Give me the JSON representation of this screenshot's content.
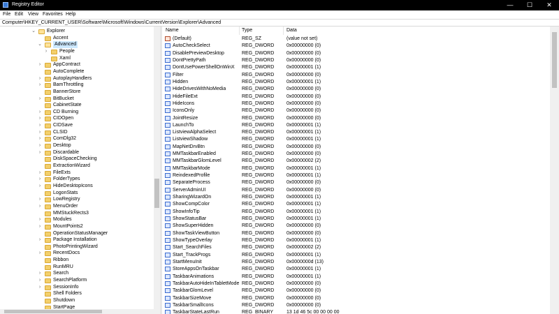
{
  "window": {
    "title": "Registry Editor",
    "minimize": "—",
    "maximize": "☐",
    "close": "✕"
  },
  "menu": [
    "File",
    "Edit",
    "View",
    "Favorites",
    "Help"
  ],
  "address": "Computer\\HKEY_CURRENT_USER\\Software\\Microsoft\\Windows\\CurrentVersion\\Explorer\\Advanced",
  "tree": [
    {
      "label": "Explorer",
      "level": 0,
      "exp": "⌄",
      "open": true
    },
    {
      "label": "Accent",
      "level": 1,
      "exp": ""
    },
    {
      "label": "Advanced",
      "level": 1,
      "exp": "⌄",
      "open": true,
      "selected": true
    },
    {
      "label": "People",
      "level": 2,
      "exp": "›"
    },
    {
      "label": "Xaml",
      "level": 2,
      "exp": ""
    },
    {
      "label": "AppContract",
      "level": 1,
      "exp": "›"
    },
    {
      "label": "AutoComplete",
      "level": 1,
      "exp": ""
    },
    {
      "label": "AutoplayHandlers",
      "level": 1,
      "exp": "›"
    },
    {
      "label": "BamThrottling",
      "level": 1,
      "exp": "›"
    },
    {
      "label": "BannerStore",
      "level": 1,
      "exp": ""
    },
    {
      "label": "BitBucket",
      "level": 1,
      "exp": "›"
    },
    {
      "label": "CabinetState",
      "level": 1,
      "exp": ""
    },
    {
      "label": "CD Burning",
      "level": 1,
      "exp": "›"
    },
    {
      "label": "CIDOpen",
      "level": 1,
      "exp": "›"
    },
    {
      "label": "CIDSave",
      "level": 1,
      "exp": "›"
    },
    {
      "label": "CLSID",
      "level": 1,
      "exp": "›"
    },
    {
      "label": "ComDlg32",
      "level": 1,
      "exp": "›"
    },
    {
      "label": "Desktop",
      "level": 1,
      "exp": "›"
    },
    {
      "label": "Discardable",
      "level": 1,
      "exp": "›"
    },
    {
      "label": "DiskSpaceChecking",
      "level": 1,
      "exp": ""
    },
    {
      "label": "ExtractionWizard",
      "level": 1,
      "exp": ""
    },
    {
      "label": "FileExts",
      "level": 1,
      "exp": "›"
    },
    {
      "label": "FolderTypes",
      "level": 1,
      "exp": "›"
    },
    {
      "label": "HideDesktopIcons",
      "level": 1,
      "exp": "›"
    },
    {
      "label": "LogonStats",
      "level": 1,
      "exp": ""
    },
    {
      "label": "LowRegistry",
      "level": 1,
      "exp": "›"
    },
    {
      "label": "MenuOrder",
      "level": 1,
      "exp": "›"
    },
    {
      "label": "MMStuckRects3",
      "level": 1,
      "exp": ""
    },
    {
      "label": "Modules",
      "level": 1,
      "exp": "›"
    },
    {
      "label": "MountPoints2",
      "level": 1,
      "exp": "›"
    },
    {
      "label": "OperationStatusManager",
      "level": 1,
      "exp": ""
    },
    {
      "label": "Package Installation",
      "level": 1,
      "exp": "›"
    },
    {
      "label": "PhotoPrintingWizard",
      "level": 1,
      "exp": ""
    },
    {
      "label": "RecentDocs",
      "level": 1,
      "exp": "›"
    },
    {
      "label": "Ribbon",
      "level": 1,
      "exp": ""
    },
    {
      "label": "RunMRU",
      "level": 1,
      "exp": ""
    },
    {
      "label": "Search",
      "level": 1,
      "exp": "›"
    },
    {
      "label": "SearchPlatform",
      "level": 1,
      "exp": "›"
    },
    {
      "label": "SessionInfo",
      "level": 1,
      "exp": "›"
    },
    {
      "label": "Shell Folders",
      "level": 1,
      "exp": ""
    },
    {
      "label": "Shutdown",
      "level": 1,
      "exp": ""
    },
    {
      "label": "StartPage",
      "level": 1,
      "exp": ""
    }
  ],
  "columns": [
    "Name",
    "Type",
    "Data"
  ],
  "values": [
    {
      "name": "(Default)",
      "type": "REG_SZ",
      "data": "(value not set)",
      "icon": "string"
    },
    {
      "name": "AutoCheckSelect",
      "type": "REG_DWORD",
      "data": "0x00000000 (0)",
      "icon": "binary"
    },
    {
      "name": "DisablePreviewDesktop",
      "type": "REG_DWORD",
      "data": "0x00000000 (0)",
      "icon": "binary"
    },
    {
      "name": "DontPrettyPath",
      "type": "REG_DWORD",
      "data": "0x00000000 (0)",
      "icon": "binary"
    },
    {
      "name": "DontUsePowerShellOnWinX",
      "type": "REG_DWORD",
      "data": "0x00000001 (1)",
      "icon": "binary"
    },
    {
      "name": "Filter",
      "type": "REG_DWORD",
      "data": "0x00000000 (0)",
      "icon": "binary"
    },
    {
      "name": "Hidden",
      "type": "REG_DWORD",
      "data": "0x00000001 (1)",
      "icon": "binary"
    },
    {
      "name": "HideDrivesWithNoMedia",
      "type": "REG_DWORD",
      "data": "0x00000000 (0)",
      "icon": "binary"
    },
    {
      "name": "HideFileExt",
      "type": "REG_DWORD",
      "data": "0x00000000 (0)",
      "icon": "binary"
    },
    {
      "name": "HideIcons",
      "type": "REG_DWORD",
      "data": "0x00000000 (0)",
      "icon": "binary"
    },
    {
      "name": "IconsOnly",
      "type": "REG_DWORD",
      "data": "0x00000000 (0)",
      "icon": "binary"
    },
    {
      "name": "JointResize",
      "type": "REG_DWORD",
      "data": "0x00000000 (0)",
      "icon": "binary"
    },
    {
      "name": "LaunchTo",
      "type": "REG_DWORD",
      "data": "0x00000001 (1)",
      "icon": "binary"
    },
    {
      "name": "ListviewAlphaSelect",
      "type": "REG_DWORD",
      "data": "0x00000001 (1)",
      "icon": "binary"
    },
    {
      "name": "ListviewShadow",
      "type": "REG_DWORD",
      "data": "0x00000001 (1)",
      "icon": "binary"
    },
    {
      "name": "MapNetDrvBtn",
      "type": "REG_DWORD",
      "data": "0x00000000 (0)",
      "icon": "binary"
    },
    {
      "name": "MMTaskbarEnabled",
      "type": "REG_DWORD",
      "data": "0x00000000 (0)",
      "icon": "binary"
    },
    {
      "name": "MMTaskbarGlomLevel",
      "type": "REG_DWORD",
      "data": "0x00000002 (2)",
      "icon": "binary"
    },
    {
      "name": "MMTaskbarMode",
      "type": "REG_DWORD",
      "data": "0x00000001 (1)",
      "icon": "binary"
    },
    {
      "name": "ReindexedProfile",
      "type": "REG_DWORD",
      "data": "0x00000001 (1)",
      "icon": "binary"
    },
    {
      "name": "SeparateProcess",
      "type": "REG_DWORD",
      "data": "0x00000000 (0)",
      "icon": "binary"
    },
    {
      "name": "ServerAdminUI",
      "type": "REG_DWORD",
      "data": "0x00000000 (0)",
      "icon": "binary"
    },
    {
      "name": "SharingWizardOn",
      "type": "REG_DWORD",
      "data": "0x00000001 (1)",
      "icon": "binary"
    },
    {
      "name": "ShowCompColor",
      "type": "REG_DWORD",
      "data": "0x00000001 (1)",
      "icon": "binary"
    },
    {
      "name": "ShowInfoTip",
      "type": "REG_DWORD",
      "data": "0x00000001 (1)",
      "icon": "binary"
    },
    {
      "name": "ShowStatusBar",
      "type": "REG_DWORD",
      "data": "0x00000001 (1)",
      "icon": "binary"
    },
    {
      "name": "ShowSuperHidden",
      "type": "REG_DWORD",
      "data": "0x00000000 (0)",
      "icon": "binary"
    },
    {
      "name": "ShowTaskViewButton",
      "type": "REG_DWORD",
      "data": "0x00000000 (0)",
      "icon": "binary"
    },
    {
      "name": "ShowTypeOverlay",
      "type": "REG_DWORD",
      "data": "0x00000001 (1)",
      "icon": "binary"
    },
    {
      "name": "Start_SearchFiles",
      "type": "REG_DWORD",
      "data": "0x00000002 (2)",
      "icon": "binary"
    },
    {
      "name": "Start_TrackProgs",
      "type": "REG_DWORD",
      "data": "0x00000001 (1)",
      "icon": "binary"
    },
    {
      "name": "StartMenuInit",
      "type": "REG_DWORD",
      "data": "0x0000000d (13)",
      "icon": "binary"
    },
    {
      "name": "StoreAppsOnTaskbar",
      "type": "REG_DWORD",
      "data": "0x00000001 (1)",
      "icon": "binary"
    },
    {
      "name": "TaskbarAnimations",
      "type": "REG_DWORD",
      "data": "0x00000001 (1)",
      "icon": "binary"
    },
    {
      "name": "TaskbarAutoHideInTabletMode",
      "type": "REG_DWORD",
      "data": "0x00000000 (0)",
      "icon": "binary"
    },
    {
      "name": "TaskbarGlomLevel",
      "type": "REG_DWORD",
      "data": "0x00000000 (0)",
      "icon": "binary"
    },
    {
      "name": "TaskbarSizeMove",
      "type": "REG_DWORD",
      "data": "0x00000000 (0)",
      "icon": "binary"
    },
    {
      "name": "TaskbarSmallIcons",
      "type": "REG_DWORD",
      "data": "0x00000000 (0)",
      "icon": "binary"
    },
    {
      "name": "TaskbarStateLastRun",
      "type": "REG_BINARY",
      "data": "13 1d 46 5c 00 00 00 00",
      "icon": "binary"
    }
  ]
}
